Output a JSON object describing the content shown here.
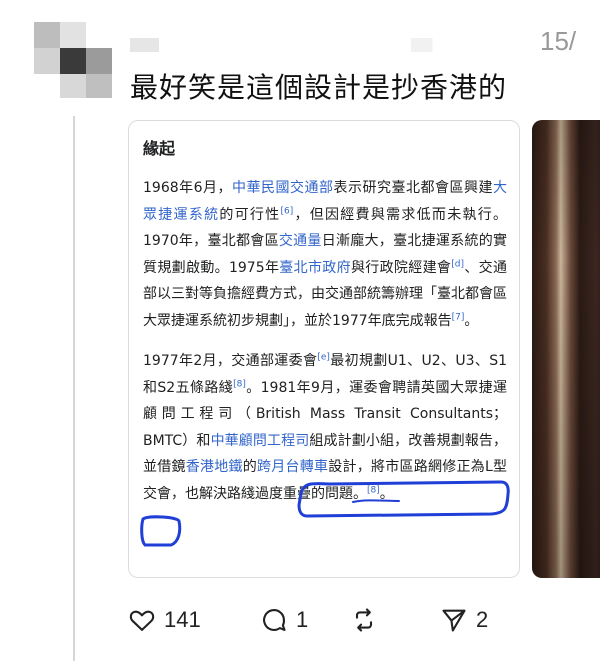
{
  "post": {
    "timestamp": "15/",
    "text": "最好笑是這個設計是抄香港的"
  },
  "card": {
    "title": "緣起",
    "para1": [
      {
        "t": "1968年6月，"
      },
      {
        "t": "中華民國交通部",
        "link": true
      },
      {
        "t": "表示研究臺北都會區興建"
      },
      {
        "t": "大眾捷運系統",
        "link": true
      },
      {
        "t": "的可行性"
      },
      {
        "t": "[6]",
        "sup": true
      },
      {
        "t": "，但因經費與需求低而未執行。1970年，臺北都會區"
      },
      {
        "t": "交通量",
        "link": true
      },
      {
        "t": "日漸龐大，臺北捷運系統的實質規劃啟動。1975年"
      },
      {
        "t": "臺北市政府",
        "link": true
      },
      {
        "t": "與行政院經建會"
      },
      {
        "t": "[d]",
        "sup": true
      },
      {
        "t": "、交通部以三對等負擔經費方式，由交通部統籌辦理「臺北都會區大眾捷運系統初步規劃」，並於1977年底完成報告"
      },
      {
        "t": "[7]",
        "sup": true
      },
      {
        "t": "。"
      }
    ],
    "para2": [
      {
        "t": "1977年2月，交通部運委會"
      },
      {
        "t": "[e]",
        "sup": true
      },
      {
        "t": "最初規劃U1、U2、U3、S1和S2五條路綫"
      },
      {
        "t": "[8]",
        "sup": true
      },
      {
        "t": "。1981年9月，運委會聘請英國大眾捷運顧問工程司（British Mass Transit Consultants；BMTC）和"
      },
      {
        "t": "中華顧問工程司",
        "link": true
      },
      {
        "t": "組成計劃小組，改善規劃報告，並借鏡"
      },
      {
        "t": "香港地鐵",
        "link": true
      },
      {
        "t": "的"
      },
      {
        "t": "跨月台轉車",
        "link": true
      },
      {
        "t": "設計，將市區路網修正為L型交會，也解決路綫過度重疊的問題。"
      },
      {
        "t": "[8]",
        "sup": true
      },
      {
        "t": "。"
      }
    ]
  },
  "actions": {
    "likes": "141",
    "replies": "1",
    "reposts": "",
    "shares": "2"
  },
  "colors": {
    "link": "#3366cc",
    "annotation": "#1f3fd6",
    "thread_line": "#d6d6d6"
  },
  "icons": [
    "heart-icon",
    "comment-icon",
    "repost-icon",
    "share-icon"
  ]
}
